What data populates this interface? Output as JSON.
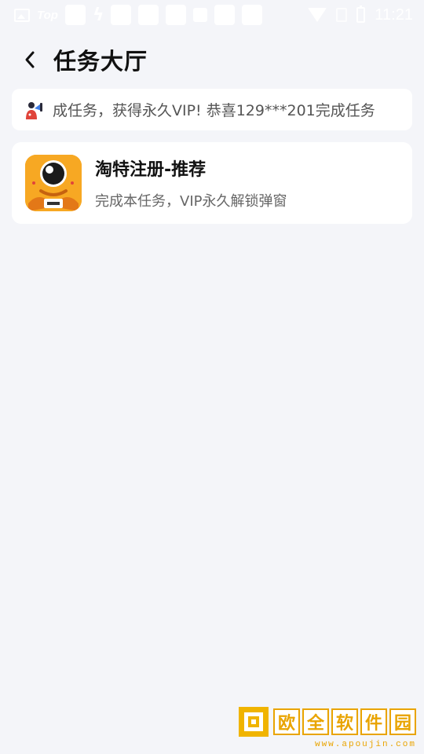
{
  "status_bar": {
    "carrier_label": "Top",
    "time": "11:21"
  },
  "header": {
    "title": "任务大厅",
    "back_icon": "chevron-left-icon"
  },
  "notice": {
    "icon": "megaphone-person-icon",
    "text": "成任务，获得永久VIP!  恭喜129***201完成任务"
  },
  "tasks": [
    {
      "icon": "taote-app-icon",
      "name": "淘特注册-推荐",
      "description": "完成本任务，VIP永久解锁弹窗"
    }
  ],
  "watermark": {
    "chars": [
      "欧",
      "全",
      "软",
      "件",
      "园"
    ],
    "url": "www.apoujin.com"
  },
  "colors": {
    "background": "#f4f5f9",
    "card": "#ffffff",
    "app_icon": "#f7a823",
    "watermark": "#e9a400"
  }
}
